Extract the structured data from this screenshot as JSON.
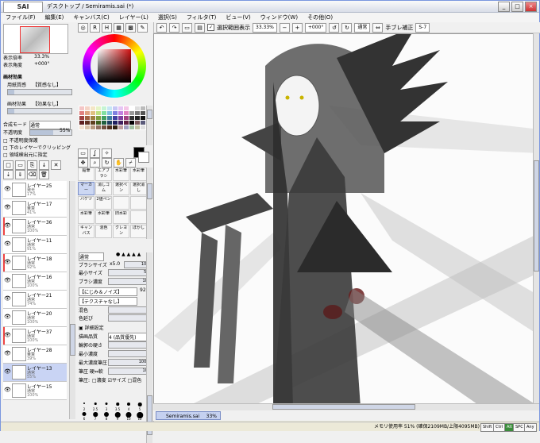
{
  "window": {
    "logo": "SAI",
    "logo_small": "PaintTool",
    "title": "デスクトップ / Semiramis.sai (*)"
  },
  "menu": [
    "ファイル(F)",
    "編集(E)",
    "キャンバス(C)",
    "レイヤー(L)",
    "選択(S)",
    "フィルタ(T)",
    "ビュー(V)",
    "ウィンドウ(W)",
    "その他(O)"
  ],
  "toolbar": {
    "selection_label": "選択範囲表示",
    "zoom": "33.33%",
    "angle": "+000°",
    "mode": "通常",
    "stab_label": "手ブレ補正",
    "stab_value": "S-7"
  },
  "navigator": {
    "zoom_label": "表示倍率",
    "zoom_value": "33.3%",
    "angle_label": "表示角度",
    "angle_value": "+000°"
  },
  "paper": {
    "section": "画材効果",
    "texture_label": "用紙質感",
    "texture_value": "【質感なし】",
    "effect_label": "画材効果",
    "effect_value": "【効果なし】"
  },
  "layer_props": {
    "blend_label": "合成モード",
    "blend_value": "通常",
    "opacity_label": "不透明度",
    "opacity_value": "55%",
    "opt1": "不透明度保護",
    "opt2": "下のレイヤーでクリッピング",
    "opt3": "領域検出元に指定"
  },
  "layers": [
    {
      "name": "レイヤー25",
      "mode": "発光",
      "opacity": "17%"
    },
    {
      "name": "レイヤー17",
      "mode": "乗算",
      "opacity": "41%"
    },
    {
      "name": "レイヤー36",
      "mode": "通常",
      "opacity": "100%"
    },
    {
      "name": "レイヤー11",
      "mode": "通常",
      "opacity": "91%"
    },
    {
      "name": "レイヤー18",
      "mode": "通常",
      "opacity": "92%"
    },
    {
      "name": "レイヤー16",
      "mode": "通常",
      "opacity": "100%"
    },
    {
      "name": "レイヤー21",
      "mode": "通常",
      "opacity": "74%"
    },
    {
      "name": "レイヤー20",
      "mode": "通常",
      "opacity": "100%"
    },
    {
      "name": "レイヤー37",
      "mode": "通常",
      "opacity": "100%"
    },
    {
      "name": "レイヤー28",
      "mode": "乗算",
      "opacity": "39%"
    },
    {
      "name": "レイヤー13",
      "mode": "通常",
      "opacity": "55%"
    },
    {
      "name": "レイヤー15",
      "mode": "通常",
      "opacity": "100%"
    }
  ],
  "tools": [
    "鉛筆",
    "エアブラシ",
    "水彩筆",
    "水彩筆",
    "マーカー",
    "消しゴム",
    "選択ペン",
    "選択消し",
    "バケツ",
    "2値ペン",
    "",
    "",
    "水彩筆",
    "水彩筆",
    "旧水彩",
    "",
    "キャンバス",
    "混色",
    "クレヨン",
    "ぼかし"
  ],
  "brush_props": {
    "mode": "通常",
    "size_label": "ブラシサイズ",
    "size_mult": "x5.0",
    "size_value": "10.0",
    "min_label": "最小サイズ",
    "min_value": "5%",
    "density_label": "ブラシ濃度",
    "density_value": "100",
    "shape": "【にじみ＆ノイズ】",
    "shape_value": "92",
    "texture": "【テクスチャなし】",
    "mix_label": "混色",
    "mix_value": "7",
    "extend_label": "色延び",
    "extend_value": "0",
    "detail": "詳細設定",
    "quality_label": "描画品質",
    "quality_value": "4 (品質優先)",
    "edge_label": "輪郭の硬さ",
    "edge_value": "0",
    "mind_label": "最小濃度",
    "mind_value": "0",
    "maxp_label": "最大濃度筆圧",
    "maxp_value": "100%",
    "hard_label": "筆圧 硬⇔軟",
    "hard_value": "102",
    "press_label": "筆圧:",
    "press_opts": "□濃度 ☑サイズ □混色"
  },
  "brush_sizes": [
    "2",
    "2.5",
    "3",
    "3.5",
    "4",
    "5",
    "6",
    "7",
    "8",
    "9",
    "10",
    "12",
    "14",
    "16",
    "20",
    "25",
    "30",
    "40"
  ],
  "canvas_tab": {
    "name": "Semiramis.sai",
    "zoom": "33%"
  },
  "status": {
    "memory": "メモリ使用率 51% (確保2109MB/上限4095MB)",
    "indicators": [
      "Shift",
      "Ctrl",
      "Alt",
      "SPC",
      "Any"
    ]
  },
  "colors": {
    "accent": "#7a8ec6",
    "selection": "#c9d4f4",
    "fg_color": "#000000"
  }
}
